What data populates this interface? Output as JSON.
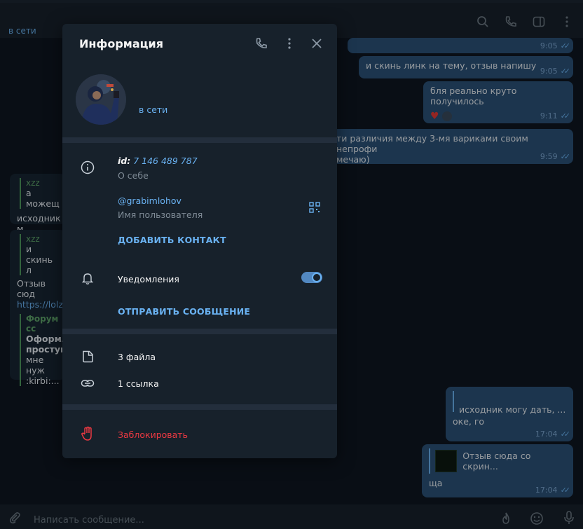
{
  "chat": {
    "status": "в сети",
    "input_placeholder": "Написать сообщение...",
    "messages": [
      {
        "time": "9:05"
      },
      {
        "text": "и скинь линк на тему, отзыв напишу",
        "time": "9:05"
      },
      {
        "text": "бля реально круто получилось",
        "time": "9:11"
      },
      {
        "text_line1": "ти различия между 3-мя вариками своим непрофи",
        "text_line2": "мечаю)",
        "time": "9:59"
      },
      {
        "quote_name": "xzz",
        "quote_text": "а можещ",
        "text": "исходник м"
      },
      {
        "quote_name": "xzz",
        "quote_text": "и скинь л",
        "text": "Отзыв сюд",
        "link": "https://lolz",
        "forum_name": "Форум сс",
        "forum_line1": "Оформлс",
        "forum_line2": "простую",
        "forum_line3": "мне нуж",
        "forum_line4": ":kirbi:..."
      },
      {
        "quote_text": "исходник могу дать, ...",
        "text": "оке, го",
        "time": "17:04"
      },
      {
        "quote_text": "Отзыв сюда со скрин...",
        "text": "ща",
        "time": "17:04"
      }
    ]
  },
  "panel": {
    "title": "Информация",
    "status": "в сети",
    "id_label": "id:",
    "id_value": "7 146 489 787",
    "about_label": "О себе",
    "username": "@grabimlohov",
    "username_label": "Имя пользователя",
    "add_contact": "ДОБАВИТЬ КОНТАКТ",
    "notifications": "Уведомления",
    "notifications_on": true,
    "send_message": "ОТПРАВИТЬ СООБЩЕНИЕ",
    "files": "3 файла",
    "links": "1 ссылка",
    "block": "Заблокировать"
  },
  "colors": {
    "accent": "#6ab2f2",
    "danger": "#ec3942",
    "panel_bg": "#17212b",
    "chat_bg": "#0e1621"
  }
}
